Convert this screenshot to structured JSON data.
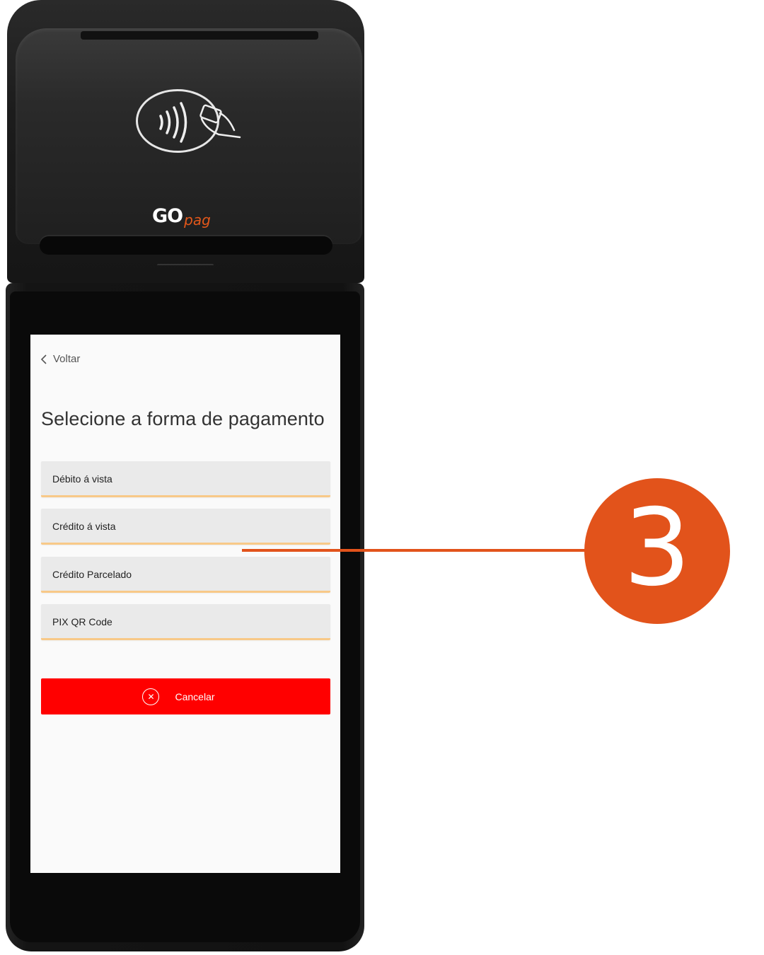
{
  "device": {
    "brand_go": "GO",
    "brand_pag": "pag",
    "brand_color": "#e2571a"
  },
  "screen": {
    "back_label": "Voltar",
    "title": "Selecione a forma de pagamento",
    "options": [
      {
        "label": "Débito á vista"
      },
      {
        "label": "Crédito á vista"
      },
      {
        "label": "Crédito Parcelado"
      },
      {
        "label": "PIX QR Code"
      }
    ],
    "cancel_label": "Cancelar",
    "cancel_color": "#ff0000"
  },
  "callout": {
    "number": "3",
    "color": "#e2531b"
  }
}
